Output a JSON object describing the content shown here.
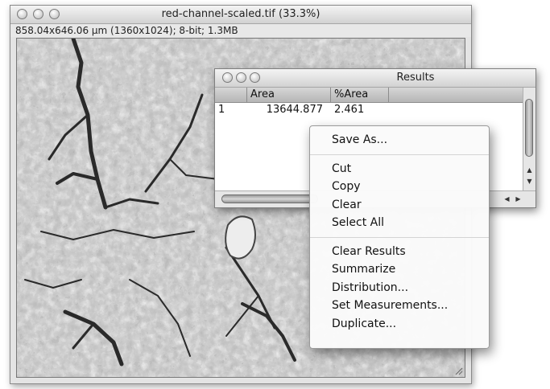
{
  "image_window": {
    "title": "red-channel-scaled.tif (33.3%)",
    "info": "858.04x646.06 µm (1360x1024); 8-bit; 1.3MB"
  },
  "results_window": {
    "title": "Results",
    "columns": [
      "",
      "Area",
      "%Area",
      ""
    ],
    "rows": [
      {
        "index": "1",
        "area": "13644.877",
        "pct_area": "2.461"
      }
    ]
  },
  "context_menu": {
    "groups": [
      [
        "Save As..."
      ],
      [
        "Cut",
        "Copy",
        "Clear",
        "Select All"
      ],
      [
        "Clear Results",
        "Summarize",
        "Distribution...",
        "Set Measurements...",
        "Duplicate..."
      ]
    ]
  },
  "icons": {
    "window_controls": "traffic-light-buttons",
    "scroll_up": "up-arrow-icon",
    "scroll_down": "down-arrow-icon",
    "scroll_left": "left-arrow-icon",
    "scroll_right": "right-arrow-icon",
    "resize": "resize-grip-icon"
  }
}
